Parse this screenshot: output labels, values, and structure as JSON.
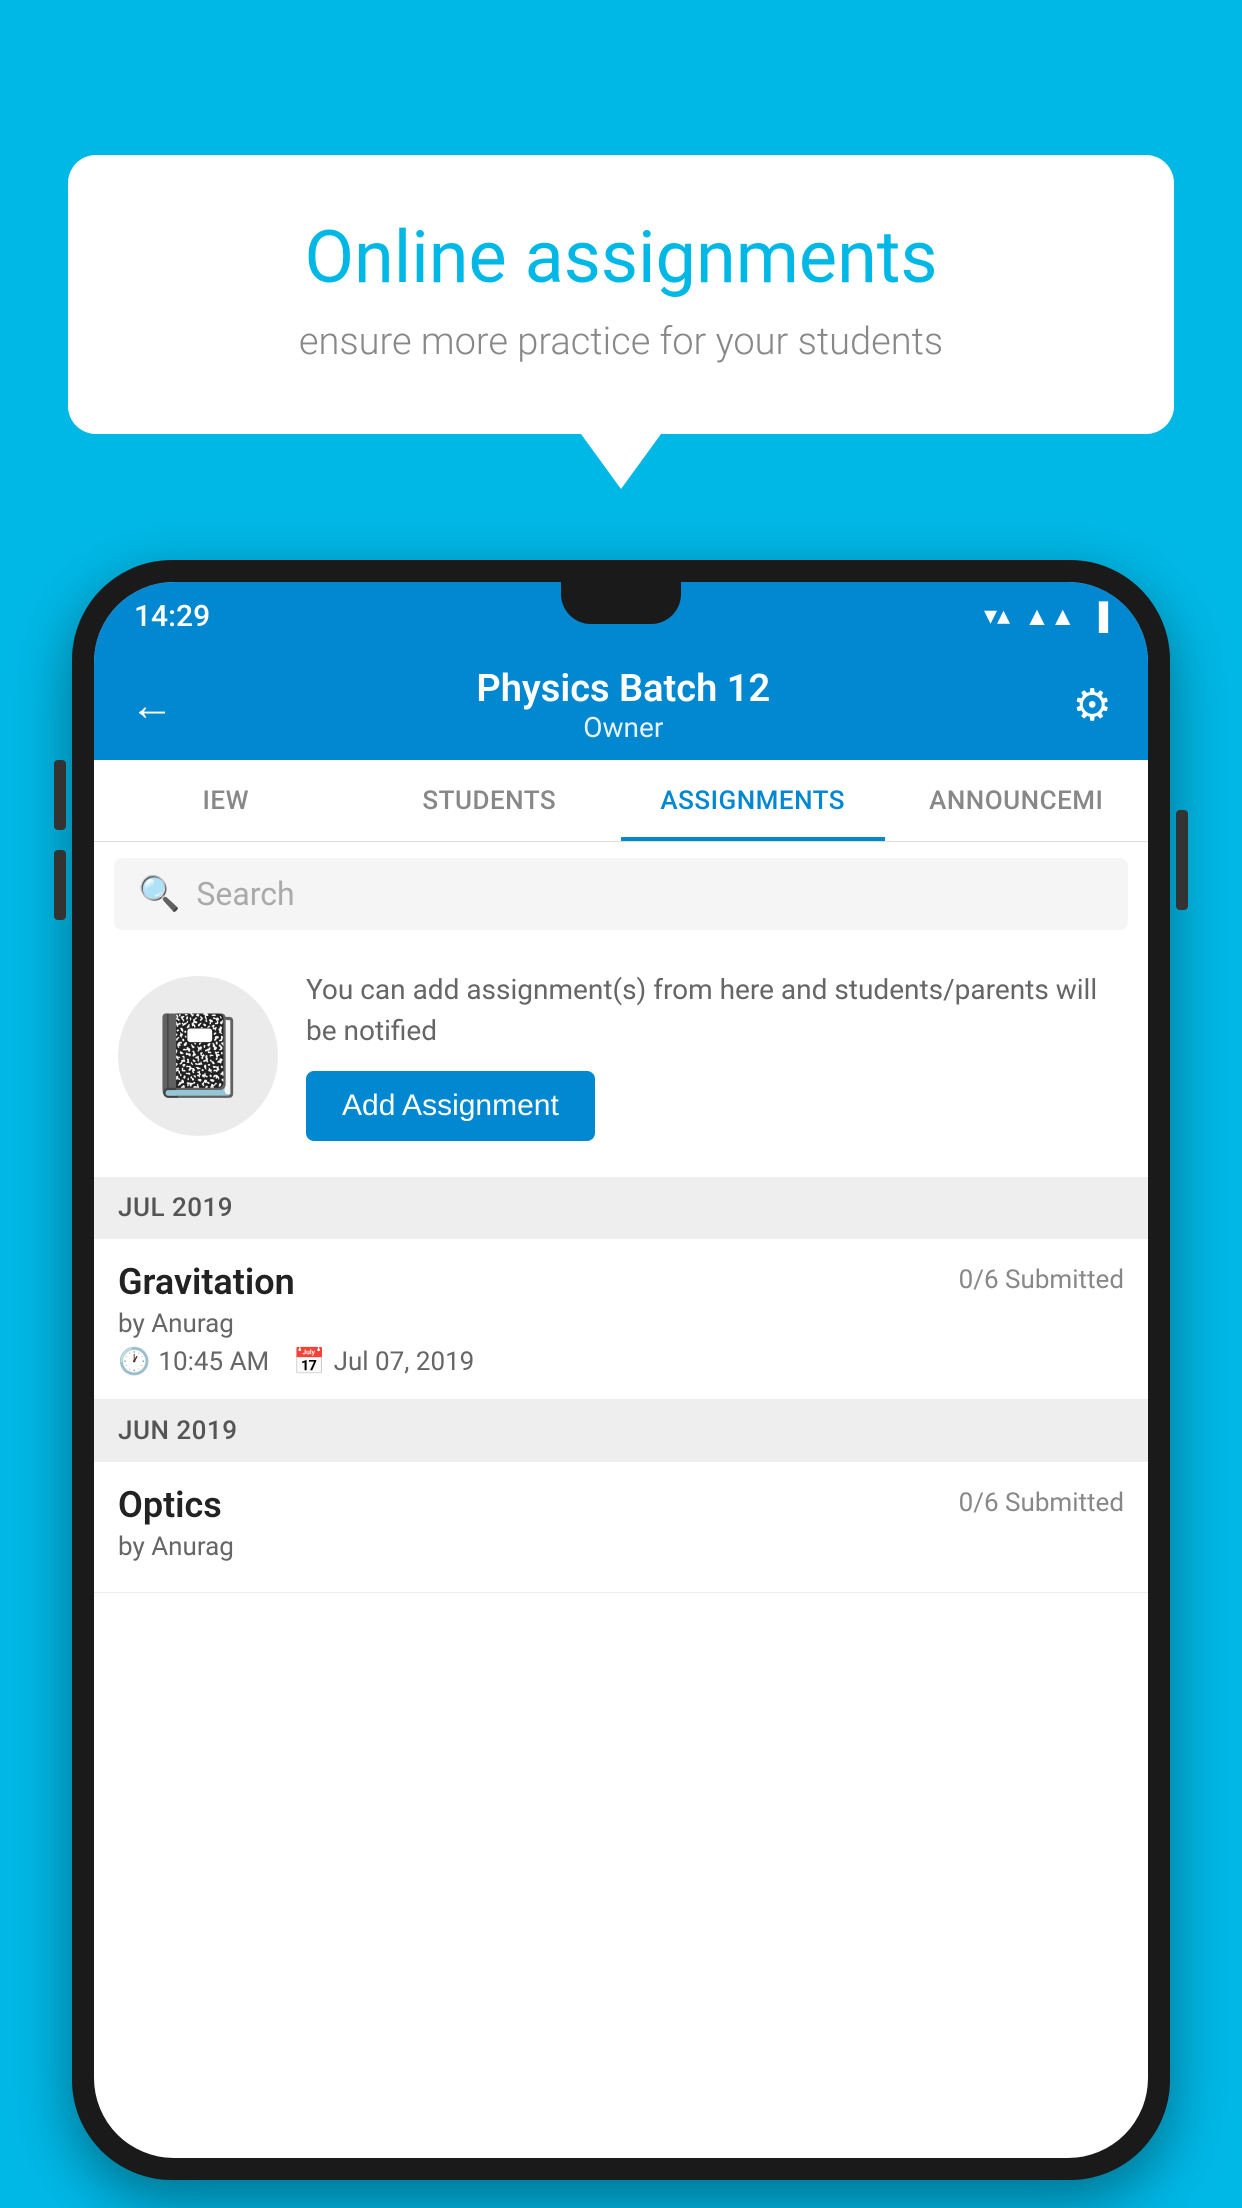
{
  "background_color": "#00b8e6",
  "speech_bubble": {
    "title": "Online assignments",
    "subtitle": "ensure more practice for your students"
  },
  "status_bar": {
    "time": "14:29",
    "icons": [
      "▾▾",
      "▲▲",
      "▌▌"
    ]
  },
  "app_header": {
    "title": "Physics Batch 12",
    "subtitle": "Owner",
    "back_label": "←",
    "settings_label": "⚙"
  },
  "tabs": [
    {
      "label": "IEW",
      "active": false
    },
    {
      "label": "STUDENTS",
      "active": false
    },
    {
      "label": "ASSIGNMENTS",
      "active": true
    },
    {
      "label": "ANNOUNCEMI",
      "active": false
    }
  ],
  "search": {
    "placeholder": "Search"
  },
  "add_assignment_card": {
    "description": "You can add assignment(s) from here and students/parents will be notified",
    "button_label": "Add Assignment"
  },
  "sections": [
    {
      "header": "JUL 2019",
      "items": [
        {
          "name": "Gravitation",
          "submitted": "0/6 Submitted",
          "by": "by Anurag",
          "time": "10:45 AM",
          "date": "Jul 07, 2019"
        }
      ]
    },
    {
      "header": "JUN 2019",
      "items": [
        {
          "name": "Optics",
          "submitted": "0/6 Submitted",
          "by": "by Anurag",
          "time": "",
          "date": ""
        }
      ]
    }
  ]
}
